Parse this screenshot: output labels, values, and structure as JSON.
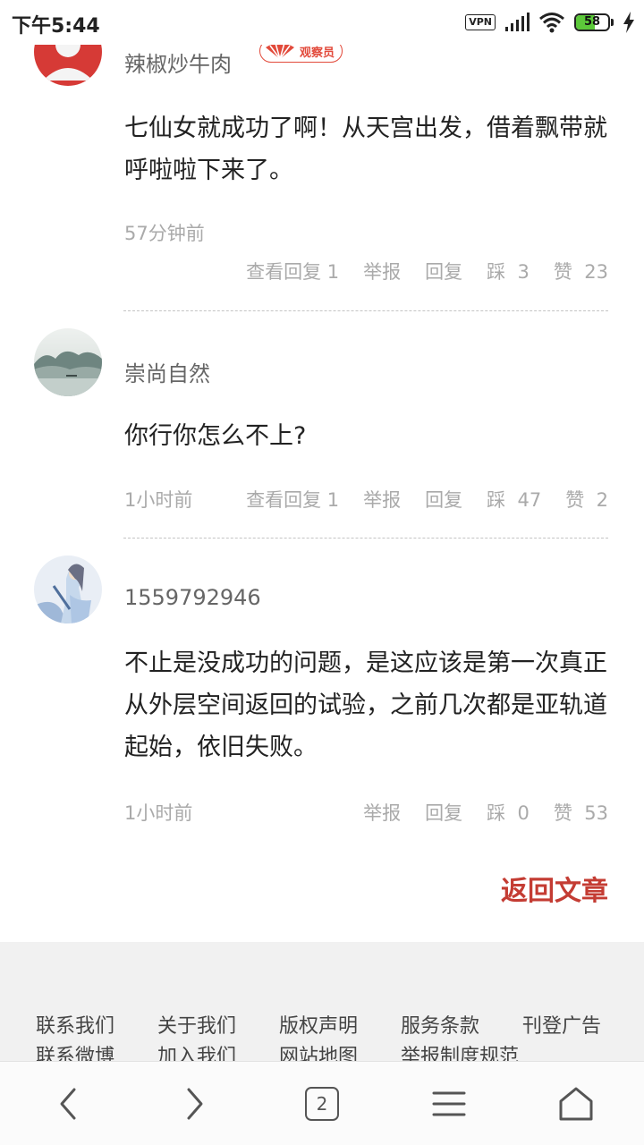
{
  "status_bar": {
    "time": "下午5:44",
    "vpn_label": "VPN",
    "battery_percent": "58",
    "battery_level": 0.58
  },
  "comments": [
    {
      "username": "辣椒炒牛肉",
      "badge": "观察员",
      "content": "七仙女就成功了啊！从天宫出发，借着飘带就呼啦啦下来了。",
      "time": "57分钟前",
      "view_replies": "查看回复 1",
      "report": "举报",
      "reply": "回复",
      "dislike": "踩",
      "dislike_count": "3",
      "like": "赞",
      "like_count": "23"
    },
    {
      "username": "崇尚自然",
      "content": "你行你怎么不上?",
      "time": "1小时前",
      "view_replies": "查看回复 1",
      "report": "举报",
      "reply": "回复",
      "dislike": "踩",
      "dislike_count": "47",
      "like": "赞",
      "like_count": "2"
    },
    {
      "username": "1559792946",
      "content": "不止是没成功的问题，是这应该是第一次真正从外层空间返回的试验，之前几次都是亚轨道起始，依旧失败。",
      "time": "1小时前",
      "report": "举报",
      "reply": "回复",
      "dislike": "踩",
      "dislike_count": "0",
      "like": "赞",
      "like_count": "53"
    }
  ],
  "back_to_article": "返回文章",
  "footer_links": [
    "联系我们",
    "关于我们",
    "版权声明",
    "服务条款",
    "刊登广告",
    "联系微博",
    "加入我们",
    "网站地图",
    "举报制度规范"
  ],
  "bottom_nav": {
    "tab_count": "2",
    "icons": [
      "back-arrow-icon",
      "forward-arrow-icon",
      "tabs-icon",
      "menu-icon",
      "home-icon"
    ]
  },
  "colors": {
    "accent_red": "#c43c33",
    "badge_red": "#e24a3b",
    "battery_green": "#5cc93a"
  }
}
